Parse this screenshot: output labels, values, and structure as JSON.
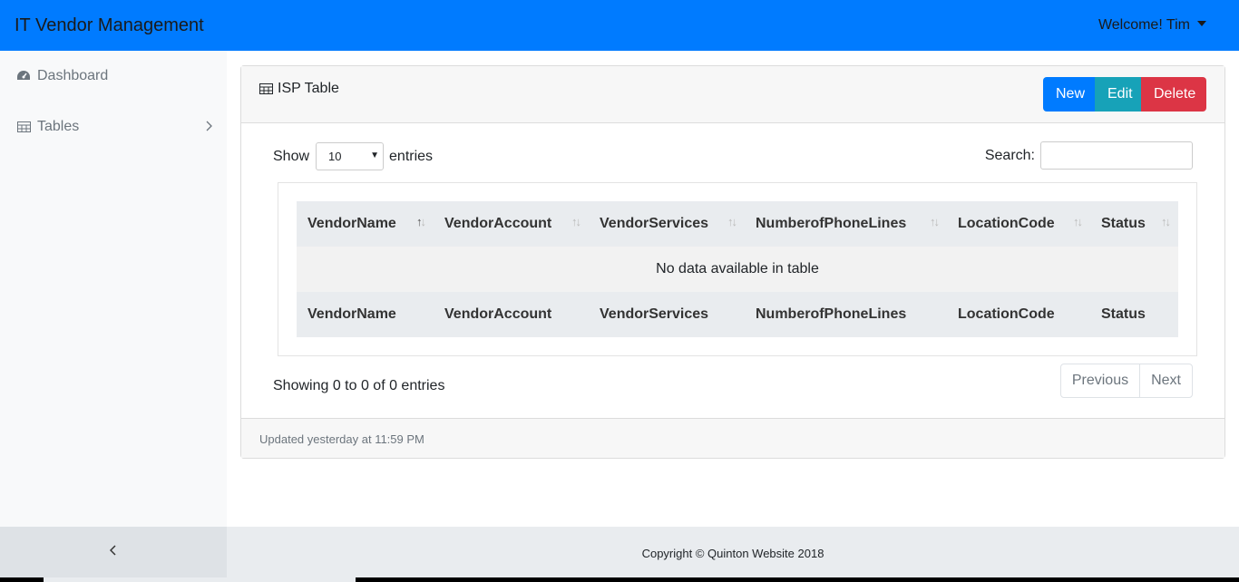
{
  "navbar": {
    "brand": "IT Vendor Management",
    "user_label": "Welcome! Tim"
  },
  "sidebar": {
    "items": [
      {
        "label": "Dashboard",
        "icon": "dashboard-icon"
      },
      {
        "label": "Tables",
        "icon": "table-icon",
        "has_submenu": true
      }
    ]
  },
  "card": {
    "title": "ISP Table",
    "buttons": {
      "new": "New",
      "edit": "Edit",
      "delete": "Delete"
    },
    "show_label": "Show",
    "page_size": "10",
    "entries_label": "entries",
    "search_label": "Search:",
    "search_value": "",
    "columns": [
      "VendorName",
      "VendorAccount",
      "VendorServices",
      "NumberofPhoneLines",
      "LocationCode",
      "Status"
    ],
    "empty_message": "No data available in table",
    "info": "Showing 0 to 0 of 0 entries",
    "pagination": {
      "previous": "Previous",
      "next": "Next"
    },
    "updated": "Updated yesterday at 11:59 PM"
  },
  "footer": {
    "copyright": "Copyright © Quinton Website 2018"
  },
  "colors": {
    "primary": "#007bff",
    "info": "#17a2b8",
    "danger": "#dc3545"
  }
}
